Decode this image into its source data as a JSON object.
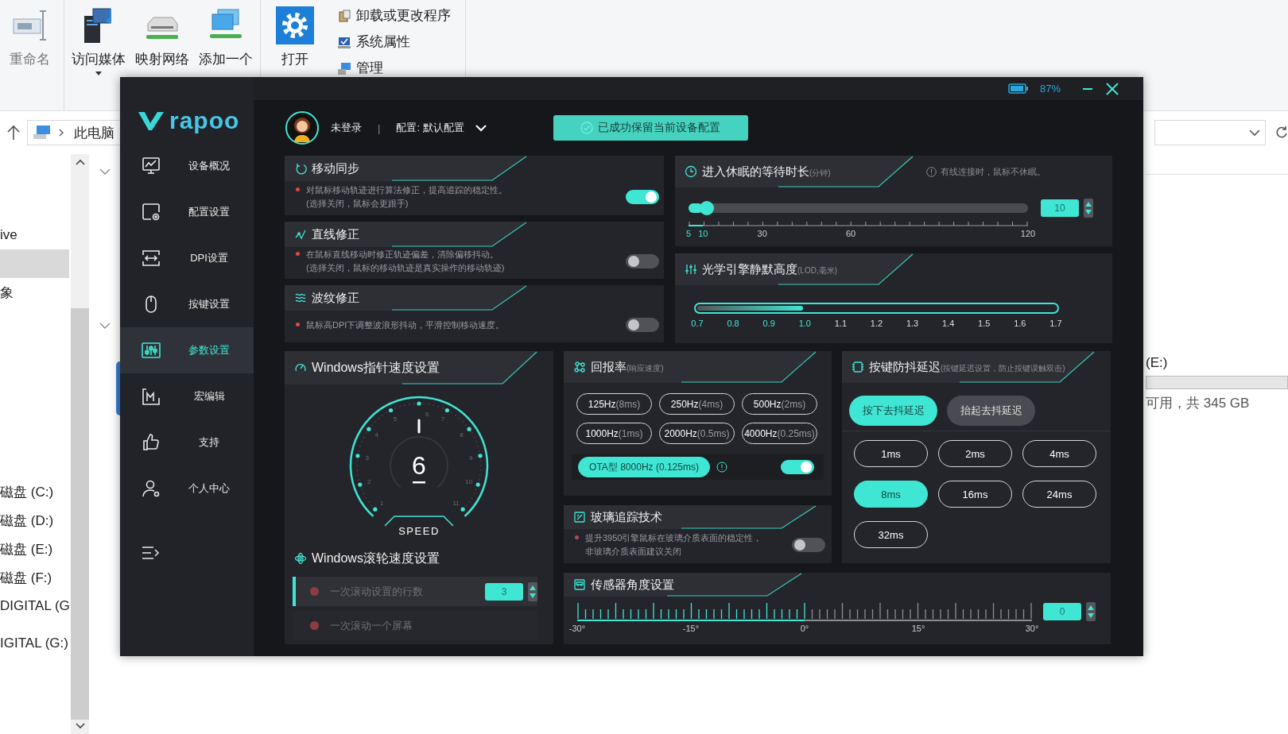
{
  "explorer": {
    "ribbon": [
      {
        "buttons": [
          {
            "lines": [
              "重命名"
            ],
            "kind": "rename",
            "dropdown": false
          }
        ]
      },
      {
        "buttons": [
          {
            "lines": [
              "访问媒体"
            ],
            "kind": "media",
            "dropdown": true
          },
          {
            "lines": [
              "映射网络"
            ],
            "kind": "drive",
            "dropdown": false
          },
          {
            "lines": [
              "添加一个"
            ],
            "kind": "network",
            "dropdown": false
          }
        ]
      },
      {
        "buttons": [
          {
            "lines": [
              "打开"
            ],
            "kind": "settings",
            "dropdown": false
          }
        ],
        "links": [
          {
            "label": "卸载或更改程序",
            "kind": "uninstall"
          },
          {
            "label": "系统属性",
            "kind": "properties"
          },
          {
            "label": "管理",
            "kind": "manage"
          }
        ]
      }
    ],
    "address": "此电脑",
    "quick_access": [
      {
        "label": "ive",
        "selected": false
      },
      {
        "selected": true
      },
      {
        "label": "象",
        "selected": false
      }
    ],
    "drives": [
      "磁盘 (C:)",
      "磁盘 (D:)",
      "磁盘 (E:)",
      "磁盘 (F:)",
      "DIGITAL (G"
    ],
    "devices": [
      "IGITAL (G:)"
    ],
    "detail": {
      "drive": "(E:)",
      "capacity": "可用，共 345 GB"
    }
  },
  "app": {
    "battery": "87%",
    "logo": "rapoo",
    "nav": [
      {
        "label": "设备概况",
        "kind": "monitor",
        "selected": false
      },
      {
        "label": "配置设置",
        "kind": "config",
        "selected": false
      },
      {
        "label": "DPI设置",
        "kind": "dpi",
        "selected": false
      },
      {
        "label": "按键设置",
        "kind": "mouse",
        "selected": false
      },
      {
        "label": "参数设置",
        "kind": "sliders",
        "selected": true
      },
      {
        "label": "宏编辑",
        "kind": "macro",
        "selected": false
      },
      {
        "label": "支持",
        "kind": "thumb",
        "selected": false
      },
      {
        "label": "个人中心",
        "kind": "person",
        "selected": false
      }
    ],
    "header": {
      "user": "未登录",
      "separator": "|",
      "profile": "配置: 默认配置",
      "notice": "已成功保留当前设备配置"
    },
    "switches": [
      {
        "title": "移动同步",
        "kind": "sync",
        "lines": [
          "对鼠标移动轨迹进行算法修正，提高追踪的稳定性。",
          "(选择关闭，鼠标会更跟手)"
        ],
        "on": true
      },
      {
        "title": "直线修正",
        "kind": "line",
        "lines": [
          "在鼠标直线移动时修正轨迹偏差，清除偏移抖动。",
          "(选择关闭，鼠标的移动轨迹是真实操作的移动轨迹)"
        ],
        "on": false
      },
      {
        "title": "波纹修正",
        "kind": "ripple",
        "lines": [
          "鼠标高DPI下调整波浪形抖动，平滑控制移动速度。"
        ],
        "on": false
      }
    ],
    "sleep": {
      "title": "进入休眠的等待时长",
      "unit": "(分钟)",
      "note": "有线连接时，鼠标不休眠。",
      "level": 0.043,
      "ticks": [
        "5",
        "10",
        "30",
        "60",
        "120"
      ],
      "value": "10"
    },
    "lod": {
      "title": "光学引擎静默高度",
      "unit": "(LOD,毫米)",
      "level": 0.3,
      "ticks": [
        "0.7",
        "0.8",
        "0.9",
        "1.0",
        "1.1",
        "1.2",
        "1.3",
        "1.4",
        "1.5",
        "1.6",
        "1.7"
      ]
    },
    "pointer": {
      "title": "Windows指针速度设置",
      "value": "6",
      "caption": "SPEED",
      "scale": [
        "1",
        "2",
        "3",
        "4",
        "5",
        "6",
        "7",
        "8",
        "9",
        "10",
        "11"
      ]
    },
    "scroll": {
      "title": "Windows滚轮速度设置",
      "options": [
        {
          "label": "一次滚动设置的行数",
          "selected": true,
          "value": "3"
        },
        {
          "label": "一次滚动一个屏幕",
          "selected": false
        }
      ]
    },
    "polling": {
      "title": "回报率",
      "unit": "(响应速度)",
      "rates": [
        {
          "rate": "125Hz",
          "period": "(8ms)",
          "selected": false
        },
        {
          "rate": "250Hz",
          "period": "(4ms)",
          "selected": false
        },
        {
          "rate": "500Hz",
          "period": "(2ms)",
          "selected": false
        },
        {
          "rate": "1000Hz",
          "period": "(1ms)",
          "selected": false
        },
        {
          "rate": "2000Hz",
          "period": "(0.5ms)",
          "selected": false
        },
        {
          "rate": "4000Hz",
          "period": "(0.25ms)",
          "selected": false
        }
      ],
      "ota": {
        "label": "OTA型 8000Hz (0.125ms)",
        "selected": true,
        "on": true
      }
    },
    "glass": {
      "title": "玻璃追踪技术",
      "lines": [
        "提升3950引擎鼠标在玻璃介质表面的稳定性，",
        "非玻璃介质表面建议关闭"
      ],
      "on": false
    },
    "debounce": {
      "title": "按键防抖延迟",
      "unit": "(按键延迟设置，防止按键误触双击)",
      "modes": [
        {
          "label": "按下去抖延迟",
          "selected": true
        },
        {
          "label": "抬起去抖延迟",
          "selected": false
        }
      ],
      "delays": [
        {
          "label": "1ms",
          "selected": false
        },
        {
          "label": "2ms",
          "selected": false
        },
        {
          "label": "4ms",
          "selected": false
        },
        {
          "label": "8ms",
          "selected": true
        },
        {
          "label": "16ms",
          "selected": false
        },
        {
          "label": "24ms",
          "selected": false
        },
        {
          "label": "32ms",
          "selected": false
        }
      ]
    },
    "angle": {
      "title": "传感器角度设置",
      "ticks": [
        "-30°",
        "-15°",
        "0°",
        "15°",
        "30°"
      ],
      "value": "0",
      "level": 0.5
    }
  }
}
